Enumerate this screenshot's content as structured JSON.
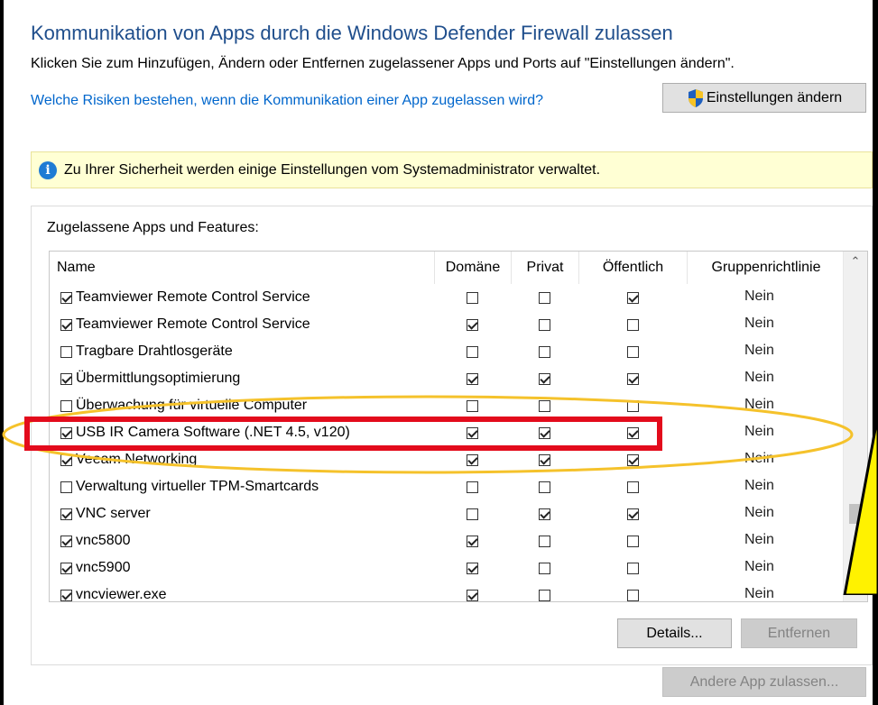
{
  "header": {
    "title": "Kommunikation von Apps durch die Windows Defender Firewall zulassen",
    "description": "Klicken Sie zum Hinzufügen, Ändern oder Entfernen zugelassener Apps und Ports auf \"Einstellungen ändern\".",
    "risk_link": "Welche Risiken bestehen, wenn die Kommunikation einer App zugelassen wird?",
    "settings_button": "Einstellungen ändern"
  },
  "info_bar": {
    "text": "Zu Ihrer Sicherheit werden einige Einstellungen vom Systemadministrator verwaltet.",
    "icon": "info-icon"
  },
  "apps": {
    "group_label": "Zugelassene Apps und Features:",
    "columns": [
      "Name",
      "Domäne",
      "Privat",
      "Öffentlich",
      "Gruppenrichtlinie"
    ],
    "rows": [
      {
        "name": "Teamviewer Remote Control Service",
        "enabled": true,
        "domain": false,
        "private": false,
        "public": true,
        "policy": "Nein"
      },
      {
        "name": "Teamviewer Remote Control Service",
        "enabled": true,
        "domain": true,
        "private": false,
        "public": false,
        "policy": "Nein"
      },
      {
        "name": "Tragbare Drahtlosgeräte",
        "enabled": false,
        "domain": false,
        "private": false,
        "public": false,
        "policy": "Nein"
      },
      {
        "name": "Übermittlungsoptimierung",
        "enabled": true,
        "domain": true,
        "private": true,
        "public": true,
        "policy": "Nein"
      },
      {
        "name": "Überwachung für virtuelle Computer",
        "enabled": false,
        "domain": false,
        "private": false,
        "public": false,
        "policy": "Nein"
      },
      {
        "name": "USB IR Camera Software (.NET 4.5, v120)",
        "enabled": true,
        "domain": true,
        "private": true,
        "public": true,
        "policy": "Nein"
      },
      {
        "name": "Veeam Networking",
        "enabled": true,
        "domain": true,
        "private": true,
        "public": true,
        "policy": "Nein"
      },
      {
        "name": "Verwaltung virtueller TPM-Smartcards",
        "enabled": false,
        "domain": false,
        "private": false,
        "public": false,
        "policy": "Nein"
      },
      {
        "name": "VNC server",
        "enabled": true,
        "domain": false,
        "private": true,
        "public": true,
        "policy": "Nein"
      },
      {
        "name": "vnc5800",
        "enabled": true,
        "domain": true,
        "private": false,
        "public": false,
        "policy": "Nein"
      },
      {
        "name": "vnc5900",
        "enabled": true,
        "domain": true,
        "private": false,
        "public": false,
        "policy": "Nein"
      },
      {
        "name": "vncviewer.exe",
        "enabled": true,
        "domain": true,
        "private": false,
        "public": false,
        "policy": "Nein"
      }
    ],
    "details_button": "Details...",
    "remove_button": "Entfernen"
  },
  "footer": {
    "add_app_button": "Andere App zulassen..."
  },
  "colors": {
    "title": "#1f4e8c",
    "link": "#0066cc",
    "highlight_rect": "#e30b1c",
    "highlight_ellipse": "#f5c22b",
    "warning_triangle": "#fff200"
  }
}
